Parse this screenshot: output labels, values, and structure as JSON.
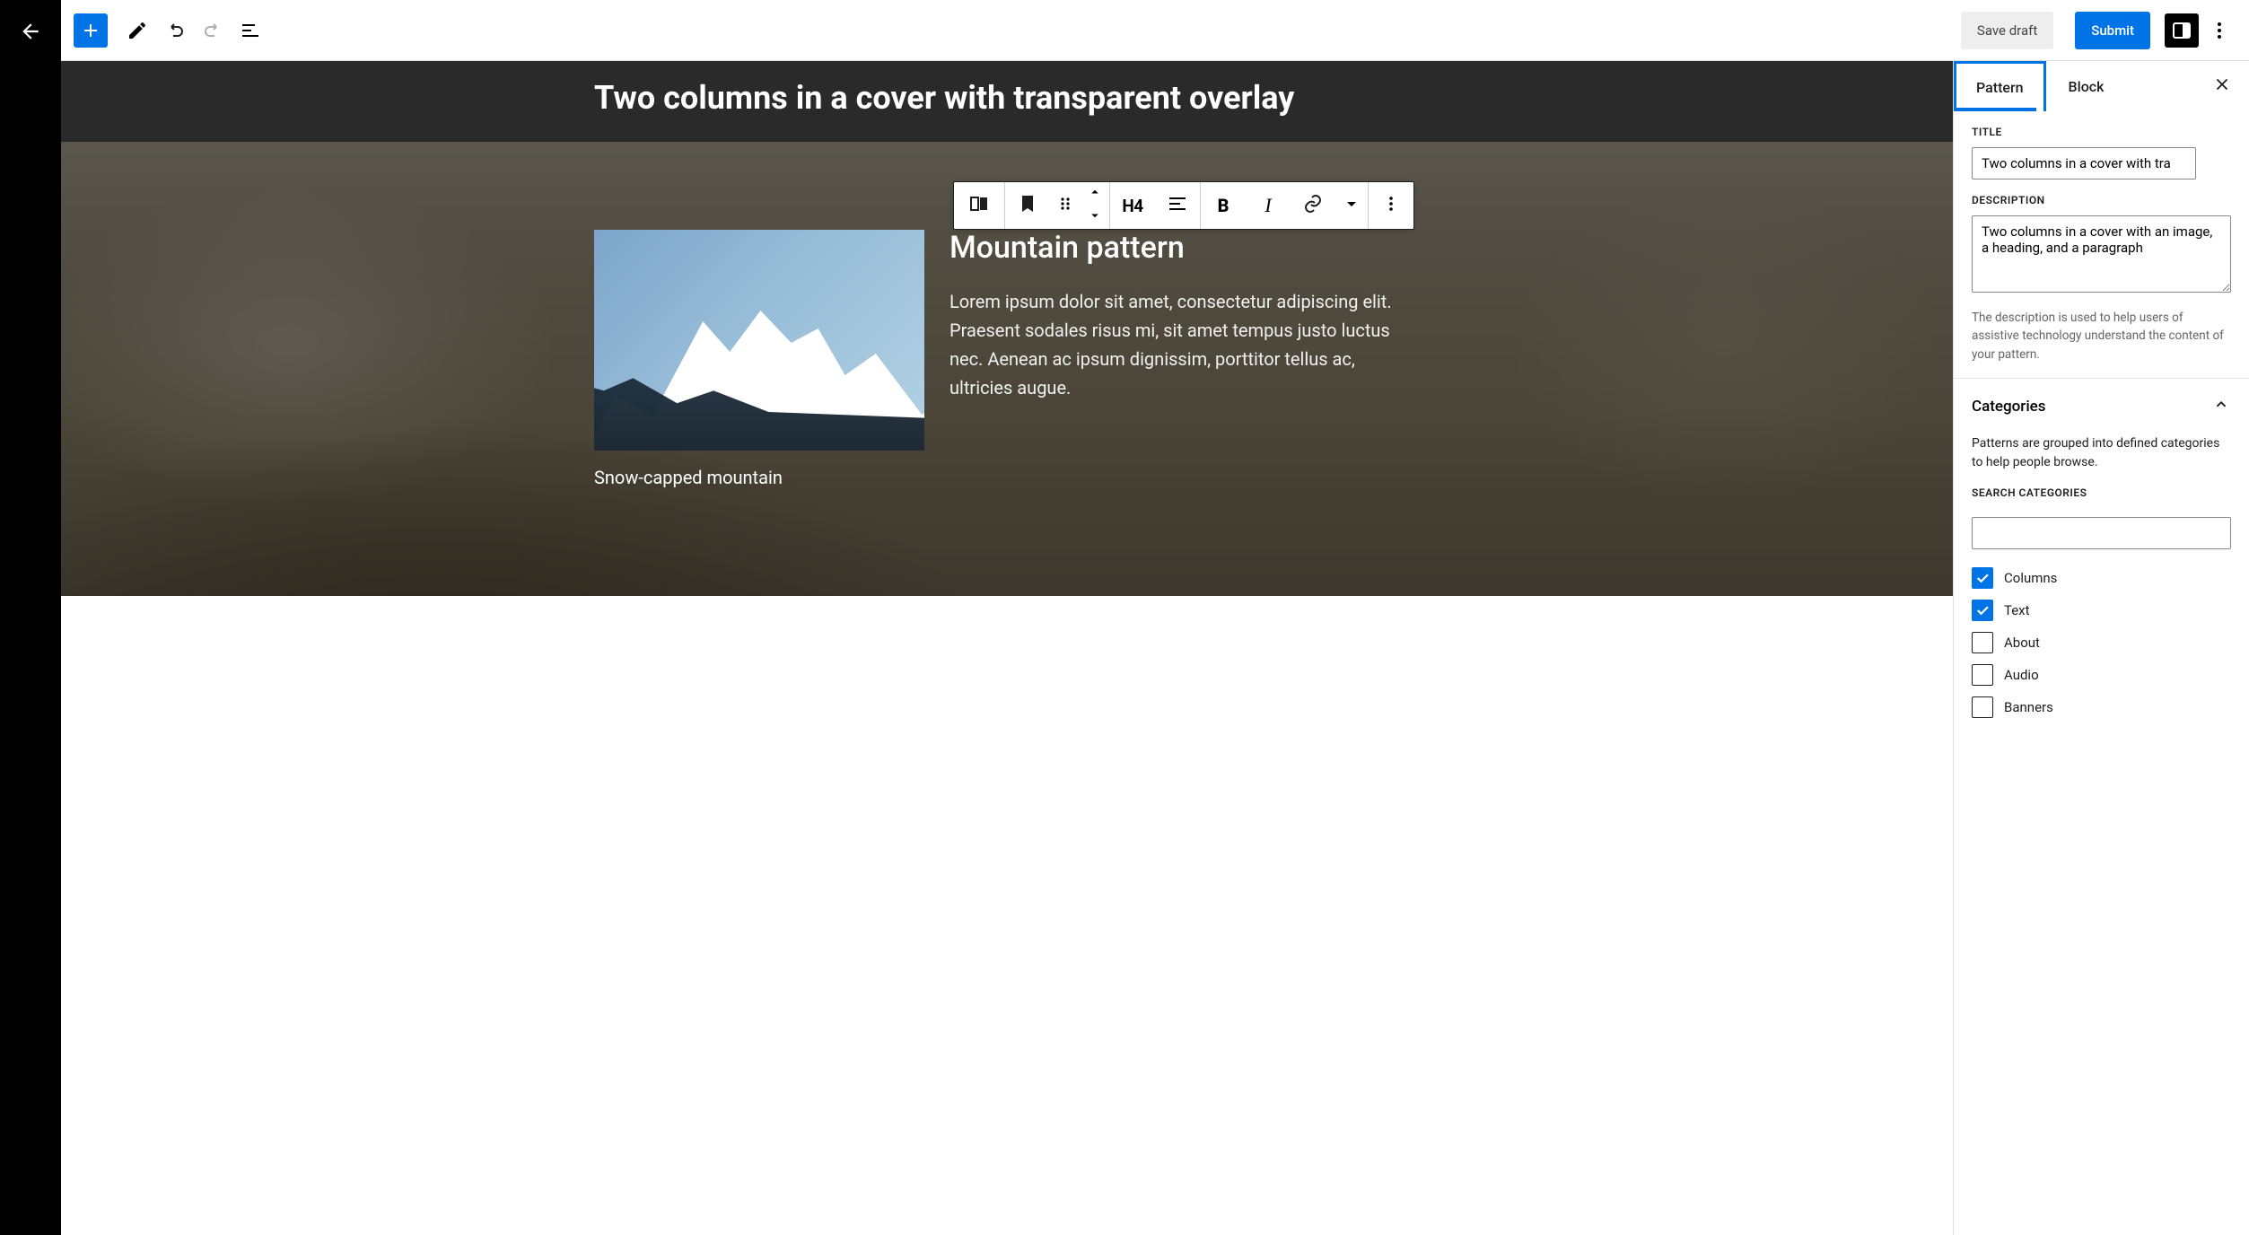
{
  "toolbar": {
    "save_draft": "Save draft",
    "submit": "Submit"
  },
  "editor": {
    "page_title": "Two columns in a cover with transparent overlay",
    "caption": "Snow-capped mountain",
    "heading": "Mountain pattern",
    "paragraph": "Lorem ipsum dolor sit amet, consectetur adipiscing elit. Praesent sodales risus mi, sit amet tempus justo luctus nec. Aenean ac ipsum dignissim, porttitor tellus ac, ultricies augue."
  },
  "block_toolbar": {
    "heading_level": "H4"
  },
  "sidebar": {
    "tabs": {
      "pattern": "Pattern",
      "block": "Block"
    },
    "title_label": "TITLE",
    "title_value": "Two columns in a cover with tra",
    "description_label": "DESCRIPTION",
    "description_value": "Two columns in a cover with an image, a heading, and a paragraph",
    "description_help": "The description is used to help users of assistive technology understand the content of your pattern.",
    "categories_heading": "Categories",
    "categories_desc": "Patterns are grouped into defined categories to help people browse.",
    "search_label": "SEARCH CATEGORIES",
    "search_value": "",
    "categories": [
      {
        "label": "Columns",
        "checked": true
      },
      {
        "label": "Text",
        "checked": true
      },
      {
        "label": "About",
        "checked": false
      },
      {
        "label": "Audio",
        "checked": false
      },
      {
        "label": "Banners",
        "checked": false
      }
    ]
  }
}
